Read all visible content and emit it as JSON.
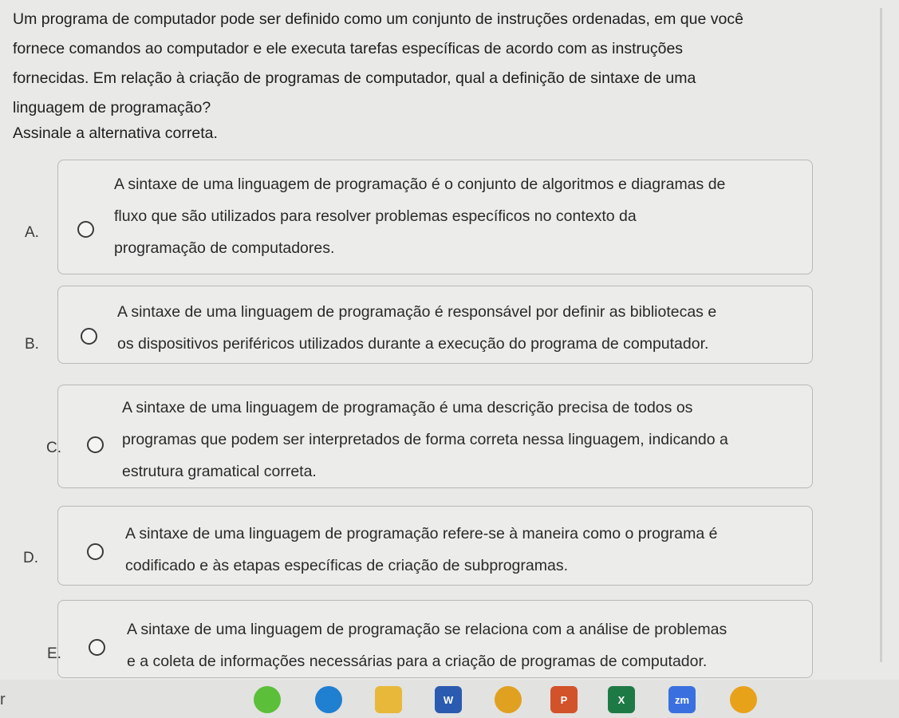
{
  "question": {
    "lines": [
      "Um programa de computador pode ser definido como um conjunto de instruções ordenadas, em que você",
      "fornece comandos ao computador e ele executa tarefas específicas de acordo com as instruções",
      "fornecidas. Em relação à criação de programas de computador, qual a definição de sintaxe de uma",
      "linguagem de programação?"
    ],
    "instruction": "Assinale a alternativa correta."
  },
  "options": [
    {
      "letter": "A.",
      "lines": [
        "A sintaxe de uma linguagem de programação é o conjunto de algoritmos e diagramas de",
        "fluxo que são utilizados para resolver problemas específicos no contexto da",
        "programação de computadores."
      ]
    },
    {
      "letter": "B.",
      "lines": [
        "A sintaxe de uma linguagem de programação é responsável por definir as bibliotecas e",
        "os dispositivos periféricos utilizados durante a execução do programa de computador."
      ]
    },
    {
      "letter": "C.",
      "lines": [
        "A sintaxe de uma linguagem de programação é uma descrição precisa de todos os",
        "programas que podem ser interpretados de forma correta nessa linguagem, indicando a",
        "estrutura gramatical correta."
      ]
    },
    {
      "letter": "D.",
      "lines": [
        "A sintaxe de uma linguagem de programação refere-se à maneira como o programa é",
        "codificado e às etapas específicas de criação de subprogramas."
      ]
    },
    {
      "letter": "E.",
      "lines": [
        "A sintaxe de uma linguagem de programação se relaciona com a análise de problemas",
        "e a coleta de informações necessárias para a criação de programas de computador."
      ]
    }
  ],
  "taskbar": {
    "edge_text": "r",
    "apps": [
      {
        "icon": "green-app-icon",
        "color": "#5bbf3a"
      },
      {
        "icon": "edge-browser-icon",
        "color": "#1f7fd0"
      },
      {
        "icon": "file-explorer-icon",
        "color": "#e8b83a"
      },
      {
        "icon": "word-icon",
        "color": "#2b5bb0",
        "label": "W"
      },
      {
        "icon": "chrome-icon",
        "color": "#e0a020"
      },
      {
        "icon": "powerpoint-icon",
        "color": "#d2522a",
        "label": "P"
      },
      {
        "icon": "excel-icon",
        "color": "#1e7a45",
        "label": "X"
      },
      {
        "icon": "zoom-icon",
        "color": "#3a6fe0",
        "label": "zm"
      },
      {
        "icon": "chrome-canary-icon",
        "color": "#e8a21a"
      }
    ]
  }
}
